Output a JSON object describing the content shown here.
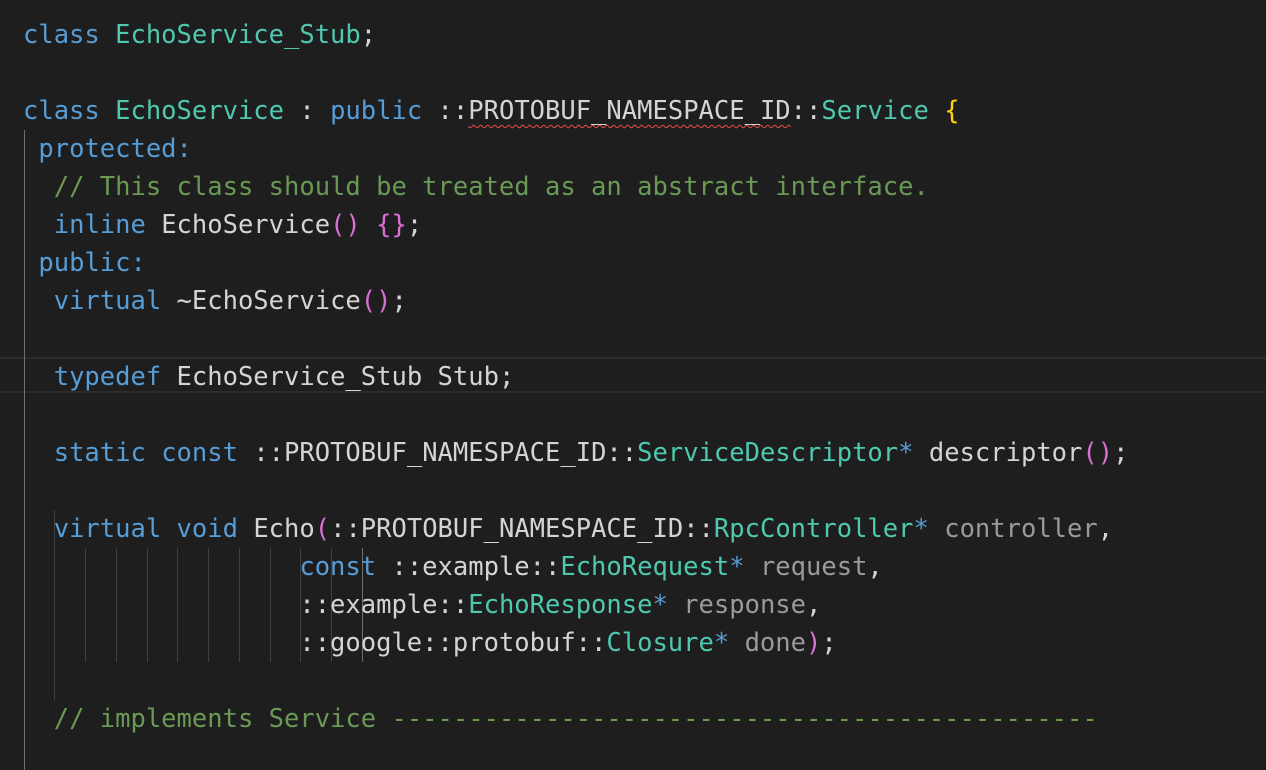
{
  "editor": {
    "lines": [
      {
        "tokens": [
          {
            "t": "class",
            "c": "kw"
          },
          {
            "t": " ",
            "c": "op"
          },
          {
            "t": "EchoService_Stub",
            "c": "ty"
          },
          {
            "t": ";",
            "c": "op"
          }
        ]
      },
      {
        "tokens": []
      },
      {
        "tokens": [
          {
            "t": "class",
            "c": "kw"
          },
          {
            "t": " ",
            "c": "op"
          },
          {
            "t": "EchoService",
            "c": "ty"
          },
          {
            "t": " : ",
            "c": "op"
          },
          {
            "t": "public",
            "c": "kw"
          },
          {
            "t": " ::",
            "c": "op"
          },
          {
            "t": "PROTOBUF_NAMESPACE_ID",
            "c": "op squiggle"
          },
          {
            "t": "::",
            "c": "op"
          },
          {
            "t": "Service",
            "c": "ty"
          },
          {
            "t": " ",
            "c": "op"
          },
          {
            "t": "{",
            "c": "br1"
          }
        ]
      },
      {
        "tokens": [
          {
            "t": " ",
            "c": "op"
          },
          {
            "t": "protected:",
            "c": "kw"
          }
        ]
      },
      {
        "tokens": [
          {
            "t": "  ",
            "c": "op"
          },
          {
            "t": "// This class should be treated as an abstract interface.",
            "c": "cm"
          }
        ]
      },
      {
        "tokens": [
          {
            "t": "  ",
            "c": "op"
          },
          {
            "t": "inline",
            "c": "kw"
          },
          {
            "t": " EchoService",
            "c": "op"
          },
          {
            "t": "()",
            "c": "br2"
          },
          {
            "t": " ",
            "c": "op"
          },
          {
            "t": "{}",
            "c": "br2"
          },
          {
            "t": ";",
            "c": "op"
          }
        ]
      },
      {
        "tokens": [
          {
            "t": " ",
            "c": "op"
          },
          {
            "t": "public:",
            "c": "kw"
          }
        ]
      },
      {
        "tokens": [
          {
            "t": "  ",
            "c": "op"
          },
          {
            "t": "virtual",
            "c": "kw"
          },
          {
            "t": " ~EchoService",
            "c": "op"
          },
          {
            "t": "()",
            "c": "br2"
          },
          {
            "t": ";",
            "c": "op"
          }
        ]
      },
      {
        "tokens": []
      },
      {
        "tokens": [
          {
            "t": "  ",
            "c": "op"
          },
          {
            "t": "typedef",
            "c": "kw"
          },
          {
            "t": " EchoService_Stub Stub;",
            "c": "op"
          }
        ]
      },
      {
        "tokens": []
      },
      {
        "tokens": [
          {
            "t": "  ",
            "c": "op"
          },
          {
            "t": "static",
            "c": "kw"
          },
          {
            "t": " ",
            "c": "op"
          },
          {
            "t": "const",
            "c": "kw"
          },
          {
            "t": " ::PROTOBUF_NAMESPACE_ID::",
            "c": "op"
          },
          {
            "t": "ServiceDescriptor",
            "c": "ty"
          },
          {
            "t": "*",
            "c": "kw"
          },
          {
            "t": " descriptor",
            "c": "op"
          },
          {
            "t": "()",
            "c": "br2"
          },
          {
            "t": ";",
            "c": "op"
          }
        ]
      },
      {
        "tokens": []
      },
      {
        "tokens": [
          {
            "t": "  ",
            "c": "op"
          },
          {
            "t": "virtual",
            "c": "kw"
          },
          {
            "t": " ",
            "c": "op"
          },
          {
            "t": "void",
            "c": "kw"
          },
          {
            "t": " Echo",
            "c": "op"
          },
          {
            "t": "(",
            "c": "br2"
          },
          {
            "t": "::PROTOBUF_NAMESPACE_ID::",
            "c": "op"
          },
          {
            "t": "RpcController",
            "c": "ty"
          },
          {
            "t": "*",
            "c": "kw"
          },
          {
            "t": " ",
            "c": "op"
          },
          {
            "t": "controller",
            "c": "param"
          },
          {
            "t": ",",
            "c": "op"
          }
        ]
      },
      {
        "tokens": [
          {
            "t": "                  ",
            "c": "op"
          },
          {
            "t": "const",
            "c": "kw"
          },
          {
            "t": " ::example::",
            "c": "op"
          },
          {
            "t": "EchoRequest",
            "c": "ty"
          },
          {
            "t": "*",
            "c": "kw"
          },
          {
            "t": " ",
            "c": "op"
          },
          {
            "t": "request",
            "c": "param"
          },
          {
            "t": ",",
            "c": "op"
          }
        ]
      },
      {
        "tokens": [
          {
            "t": "                  ",
            "c": "op"
          },
          {
            "t": "::example::",
            "c": "op"
          },
          {
            "t": "EchoResponse",
            "c": "ty"
          },
          {
            "t": "*",
            "c": "kw"
          },
          {
            "t": " ",
            "c": "op"
          },
          {
            "t": "response",
            "c": "param"
          },
          {
            "t": ",",
            "c": "op"
          }
        ]
      },
      {
        "tokens": [
          {
            "t": "                  ",
            "c": "op"
          },
          {
            "t": "::google::protobuf::",
            "c": "op"
          },
          {
            "t": "Closure",
            "c": "ty"
          },
          {
            "t": "*",
            "c": "kw"
          },
          {
            "t": " ",
            "c": "op"
          },
          {
            "t": "done",
            "c": "param"
          },
          {
            "t": ")",
            "c": "br2"
          },
          {
            "t": ";",
            "c": "op"
          }
        ]
      },
      {
        "tokens": []
      },
      {
        "tokens": [
          {
            "t": "  ",
            "c": "op"
          },
          {
            "t": "// implements Service ----------------------------------------------",
            "c": "cm"
          }
        ]
      }
    ]
  }
}
